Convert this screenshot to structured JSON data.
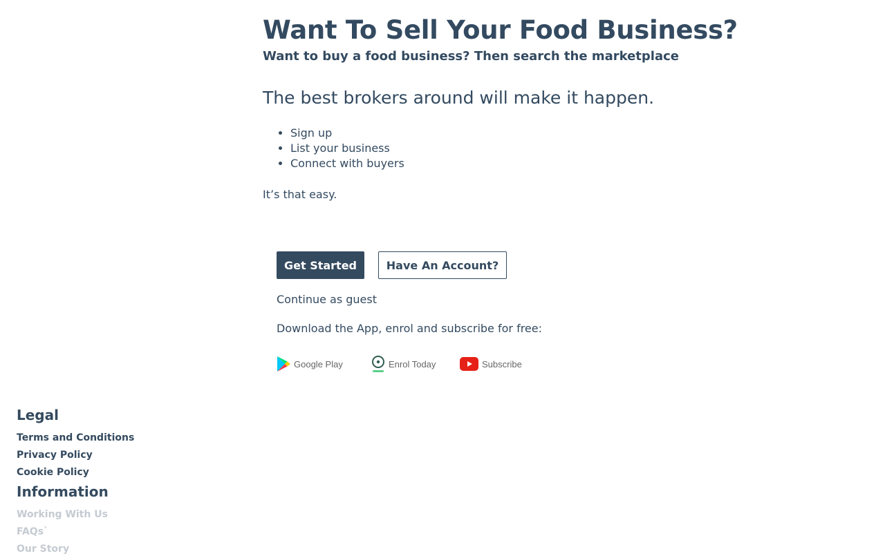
{
  "hero": {
    "title": "Want To Sell Your Food Business?",
    "subtitle": "Want to buy a food business? Then search the marketplace",
    "tagline": "The best brokers around will make it happen.",
    "steps": [
      "Sign up",
      "List your business",
      "Connect with buyers"
    ],
    "easy": "It’s that easy."
  },
  "actions": {
    "get_started": "Get Started",
    "have_account": "Have An Account?",
    "guest": "Continue as guest",
    "download": "Download the App, enrol and subscribe for free:"
  },
  "badges": {
    "google": "Google Play",
    "enrol": "Enrol Today",
    "youtube": "Subscribe",
    "google_icon": "google-play-icon",
    "enrol_icon": "location-pin-icon",
    "youtube_icon": "youtube-play-icon"
  },
  "footer": {
    "legal_title": "Legal",
    "legal_links": [
      "Terms and Conditions",
      "Privacy Policy",
      "Cookie Policy"
    ],
    "info_title": "Information",
    "info_links": [
      "Working With Us",
      "FAQs`",
      "Our Story"
    ]
  },
  "colors": {
    "primary": "#344a5f",
    "text": "#334a60",
    "muted_link": "#c5cbd2",
    "youtube_red": "#e62117"
  }
}
